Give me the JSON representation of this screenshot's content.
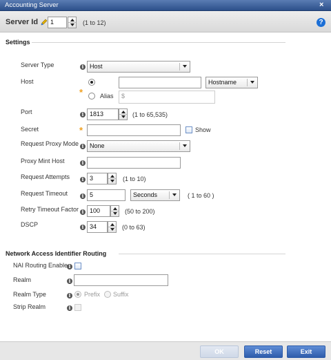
{
  "window": {
    "title": "Accounting Server"
  },
  "server_id": {
    "label": "Server Id",
    "value": "1",
    "hint": "(1 to 12)"
  },
  "settings": {
    "heading": "Settings",
    "server_type": {
      "label": "Server Type",
      "value": "Host"
    },
    "host": {
      "label": "Host",
      "value": "",
      "host_type": "Hostname",
      "alias_label": "Alias",
      "alias_value": "$"
    },
    "port": {
      "label": "Port",
      "value": "1813",
      "hint": "(1 to 65,535)"
    },
    "secret": {
      "label": "Secret",
      "value": "",
      "show_label": "Show"
    },
    "request_proxy_mode": {
      "label": "Request Proxy Mode",
      "value": "None"
    },
    "proxy_mint_host": {
      "label": "Proxy Mint Host",
      "value": ""
    },
    "request_attempts": {
      "label": "Request Attempts",
      "value": "3",
      "hint": "(1 to 10)"
    },
    "request_timeout": {
      "label": "Request Timeout",
      "value": "5",
      "unit": "Seconds",
      "hint": "( 1 to 60 )"
    },
    "retry_timeout_factor": {
      "label": "Retry Timeout Factor",
      "value": "100",
      "hint": "(50 to 200)"
    },
    "dscp": {
      "label": "DSCP",
      "value": "34",
      "hint": "(0 to 63)"
    }
  },
  "nai": {
    "heading": "Network Access Identifier Routing",
    "routing_enable": {
      "label": "NAI Routing Enable"
    },
    "realm": {
      "label": "Realm",
      "value": ""
    },
    "realm_type": {
      "label": "Realm Type",
      "prefix": "Prefix",
      "suffix": "Suffix"
    },
    "strip_realm": {
      "label": "Strip Realm"
    }
  },
  "footer": {
    "ok": "OK",
    "reset": "Reset",
    "exit": "Exit"
  },
  "icons": {
    "info": "i",
    "help": "?",
    "close": "×"
  }
}
